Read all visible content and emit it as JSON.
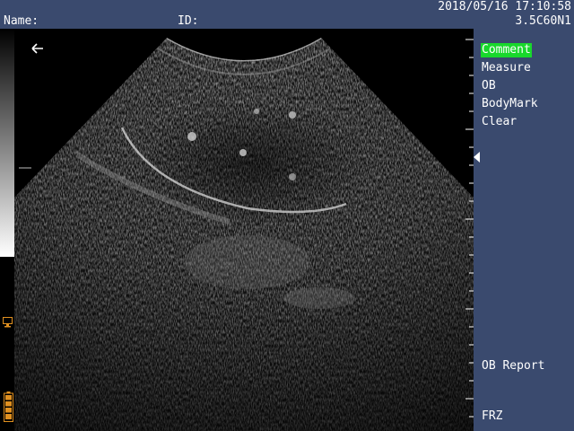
{
  "header": {
    "name_label": "Name:",
    "id_label": "ID:",
    "datetime": "2018/05/16 17:10:58",
    "probe": "3.5C60N1"
  },
  "menu": {
    "items": [
      {
        "label": "Comment",
        "active": true
      },
      {
        "label": "Measure",
        "active": false
      },
      {
        "label": "OB",
        "active": false
      },
      {
        "label": "BodyMark",
        "active": false
      },
      {
        "label": "Clear",
        "active": false
      }
    ],
    "ob_report": "OB Report",
    "freeze": "FRZ"
  },
  "icons": {
    "back": "arrow-left-icon",
    "monitor": "monitor-icon",
    "battery": "battery-icon",
    "focus_marker": "focus-marker-icon",
    "depth_marker": "depth-marker-icon"
  },
  "colors": {
    "panel_bg": "#3a4a6e",
    "highlight": "#18d82c",
    "icon_orange": "#e09020"
  }
}
